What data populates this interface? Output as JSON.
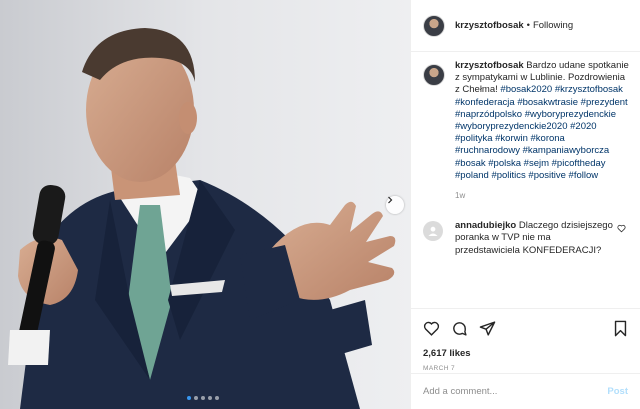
{
  "post": {
    "header": {
      "username": "krzysztofbosak",
      "separator": "•",
      "follow_status": "Following"
    },
    "caption": {
      "username": "krzysztofbosak",
      "text": "Bardzo udane spotkanie z sympatykami w Lublinie. Pozdrowienia z Chełma!",
      "hashtags": "#bosak2020 #krzysztofbosak #konfederacja #bosakwtrasie #prezydent #naprzódpolsko #wyboryprezydenckie #wyboryprezydenckie2020 #2020 #polityka #korwin #korona #ruchnarodowy #kampaniawyborcza #bosak #polska #sejm #picoftheday #poland #politics #positive #follow",
      "time": "1w"
    },
    "comments": [
      {
        "username": "annadubiejko",
        "text": "Dlaczego dzisiejszego poranka w TVP nie ma przedstawiciela KONFEDERACJI?"
      }
    ],
    "likes": "2,617 likes",
    "date": "MARCH 7",
    "add_comment": {
      "placeholder": "Add a comment...",
      "post_label": "Post"
    },
    "carousel": {
      "slides": 5,
      "active_index": 0
    },
    "icons": {
      "like": "heart-icon",
      "comment": "comment-icon",
      "share": "share-icon",
      "save": "bookmark-icon",
      "comment_like": "heart-icon",
      "next": "chevron-right-icon"
    },
    "colors": {
      "hashtag": "#003569",
      "muted": "#8e8e8e",
      "post_disabled": "#b2dffc",
      "active_dot": "#3897f0"
    }
  }
}
